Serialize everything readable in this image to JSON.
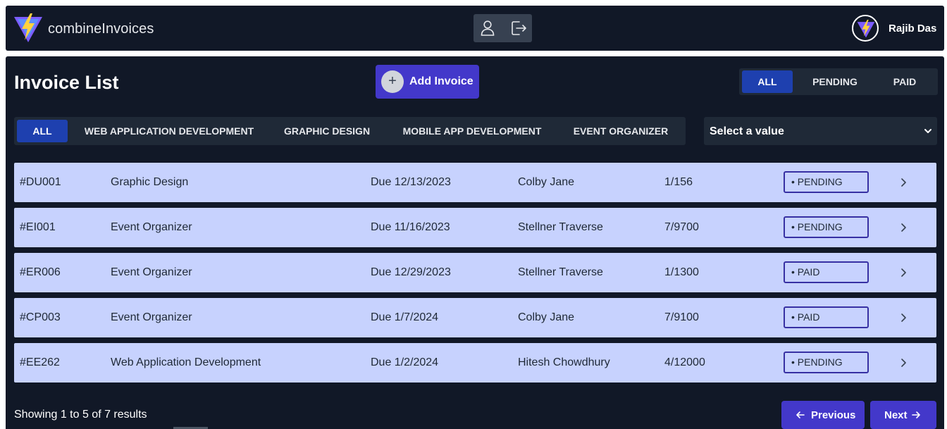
{
  "header": {
    "brand": "combineInvoices",
    "logo_icon": "vite-logo-icon",
    "icons": [
      "user-icon",
      "logout-icon"
    ],
    "user_name": "Rajib Das"
  },
  "main": {
    "title": "Invoice List",
    "add_button": "Add Invoice",
    "status_tabs": [
      {
        "label": "ALL",
        "active": true
      },
      {
        "label": "PENDING",
        "active": false
      },
      {
        "label": "PAID",
        "active": false
      }
    ],
    "category_tabs": [
      {
        "label": "ALL",
        "active": true
      },
      {
        "label": "WEB APPLICATION DEVELOPMENT",
        "active": false
      },
      {
        "label": "GRAPHIC DESIGN",
        "active": false
      },
      {
        "label": "MOBILE APP DEVELOPMENT",
        "active": false
      },
      {
        "label": "EVENT ORGANIZER",
        "active": false
      }
    ],
    "select": {
      "value": "Select a value"
    }
  },
  "invoices": [
    {
      "id": "#DU001",
      "name": "Graphic Design",
      "due": "Due 12/13/2023",
      "client": "Colby Jane",
      "amount": "1/156",
      "status": "• PENDING"
    },
    {
      "id": "#EI001",
      "name": "Event Organizer",
      "due": "Due 11/16/2023",
      "client": "Stellner Traverse",
      "amount": "7/9700",
      "status": "• PENDING"
    },
    {
      "id": "#ER006",
      "name": "Event Organizer",
      "due": "Due 12/29/2023",
      "client": "Stellner Traverse",
      "amount": "1/1300",
      "status": "• PAID"
    },
    {
      "id": "#CP003",
      "name": "Event Organizer",
      "due": "Due 1/7/2024",
      "client": "Colby Jane",
      "amount": "7/9100",
      "status": "• PAID"
    },
    {
      "id": "#EE262",
      "name": "Web Application Development",
      "due": "Due 1/2/2024",
      "client": "Hitesh Chowdhury",
      "amount": "4/12000",
      "status": "• PENDING"
    }
  ],
  "pagination": {
    "summary": "Showing 1 to 5 of 7 results",
    "previous": "Previous",
    "next": "Next"
  },
  "colors": {
    "background": "#111827",
    "accent": "#4338ca",
    "active_tab": "#1e40af",
    "row": "#c7d2fe"
  }
}
